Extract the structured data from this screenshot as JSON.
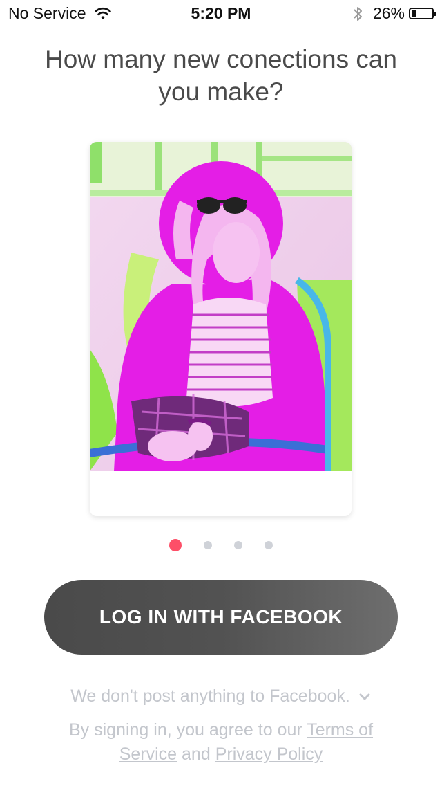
{
  "status_bar": {
    "carrier": "No Service",
    "time": "5:20 PM",
    "battery_percent": "26%",
    "battery_level": 0.26,
    "wifi_icon": "wifi-icon",
    "bluetooth_icon": "bluetooth-icon"
  },
  "onboarding": {
    "headline": "How many new conections can you make?",
    "card_image": "woman-in-sunglasses-photo-with-pink-person-silhouette",
    "page_count": 4,
    "current_page": 1
  },
  "login": {
    "button_label": "LOG IN WITH FACEBOOK"
  },
  "footer": {
    "no_post_text": "We don't post anything to Facebook.",
    "no_post_icon": "chevron-down-icon",
    "terms_prefix": "By signing in, you agree to our ",
    "terms_link": "Terms of Service",
    "terms_and": " and ",
    "privacy_link": "Privacy Policy"
  },
  "colors": {
    "accent": "#fd4f68",
    "dot_inactive": "#cfd2d8",
    "button_dark": "#4a4a4a",
    "footer_text": "#c3c6cc",
    "silhouette_pink": "#e41ee6",
    "photo_green": "#7fe33a"
  }
}
